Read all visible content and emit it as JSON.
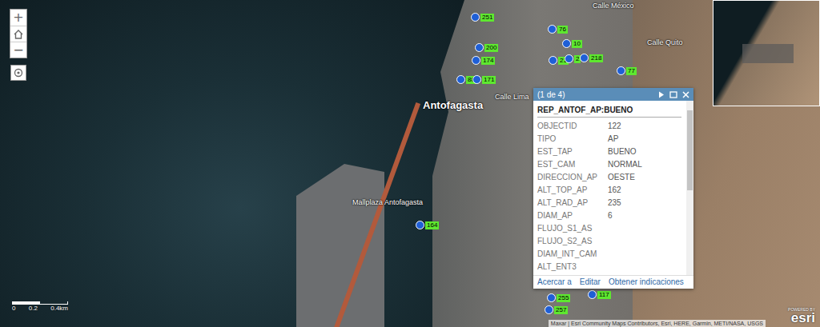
{
  "map": {
    "labels": [
      {
        "text": "Antofagasta",
        "kind": "city"
      },
      {
        "text": "Mallplaza Antofagasta",
        "kind": "poi"
      },
      {
        "text": "Calle Lima",
        "kind": "street"
      },
      {
        "text": "Calle México",
        "kind": "street"
      },
      {
        "text": "Calle Quito",
        "kind": "street"
      }
    ],
    "pins": [
      {
        "label": "251"
      },
      {
        "label": "76"
      },
      {
        "label": "200"
      },
      {
        "label": "10"
      },
      {
        "label": "174"
      },
      {
        "label": "21"
      },
      {
        "label": "2"
      },
      {
        "label": "218"
      },
      {
        "label": "88"
      },
      {
        "label": "171"
      },
      {
        "label": "77"
      },
      {
        "label": "164"
      },
      {
        "label": "255"
      },
      {
        "label": "257"
      },
      {
        "label": "117"
      }
    ]
  },
  "zoom_controls": [
    "+",
    "−"
  ],
  "scale_bar": {
    "ticks": [
      "0",
      "0.2",
      "0.4km"
    ]
  },
  "popup": {
    "pager": "(1 de 4)",
    "title": "REP_ANTOF_AP:BUENO",
    "fields": [
      {
        "name": "OBJECTID",
        "value": "122"
      },
      {
        "name": "TIPO",
        "value": "AP"
      },
      {
        "name": "EST_TAP",
        "value": "BUENO"
      },
      {
        "name": "EST_CAM",
        "value": "NORMAL"
      },
      {
        "name": "DIRECCION_AP",
        "value": "OESTE"
      },
      {
        "name": "ALT_TOP_AP",
        "value": "162"
      },
      {
        "name": "ALT_RAD_AP",
        "value": "235"
      },
      {
        "name": "DIAM_AP",
        "value": "6"
      },
      {
        "name": "FLUJO_S1_AS",
        "value": ""
      },
      {
        "name": "FLUJO_S2_AS",
        "value": ""
      },
      {
        "name": "DIAM_INT_CAM",
        "value": ""
      },
      {
        "name": "ALT_ENT3",
        "value": ""
      }
    ],
    "actions": [
      "Acercar a",
      "Editar",
      "Obtener indicaciones"
    ]
  },
  "attribution": "Maxar | Esri Community Maps Contributors, Esri, HERE, Garmin, METI/NASA, USGS",
  "powered_by": {
    "small": "POWERED BY",
    "brand": "esri"
  }
}
